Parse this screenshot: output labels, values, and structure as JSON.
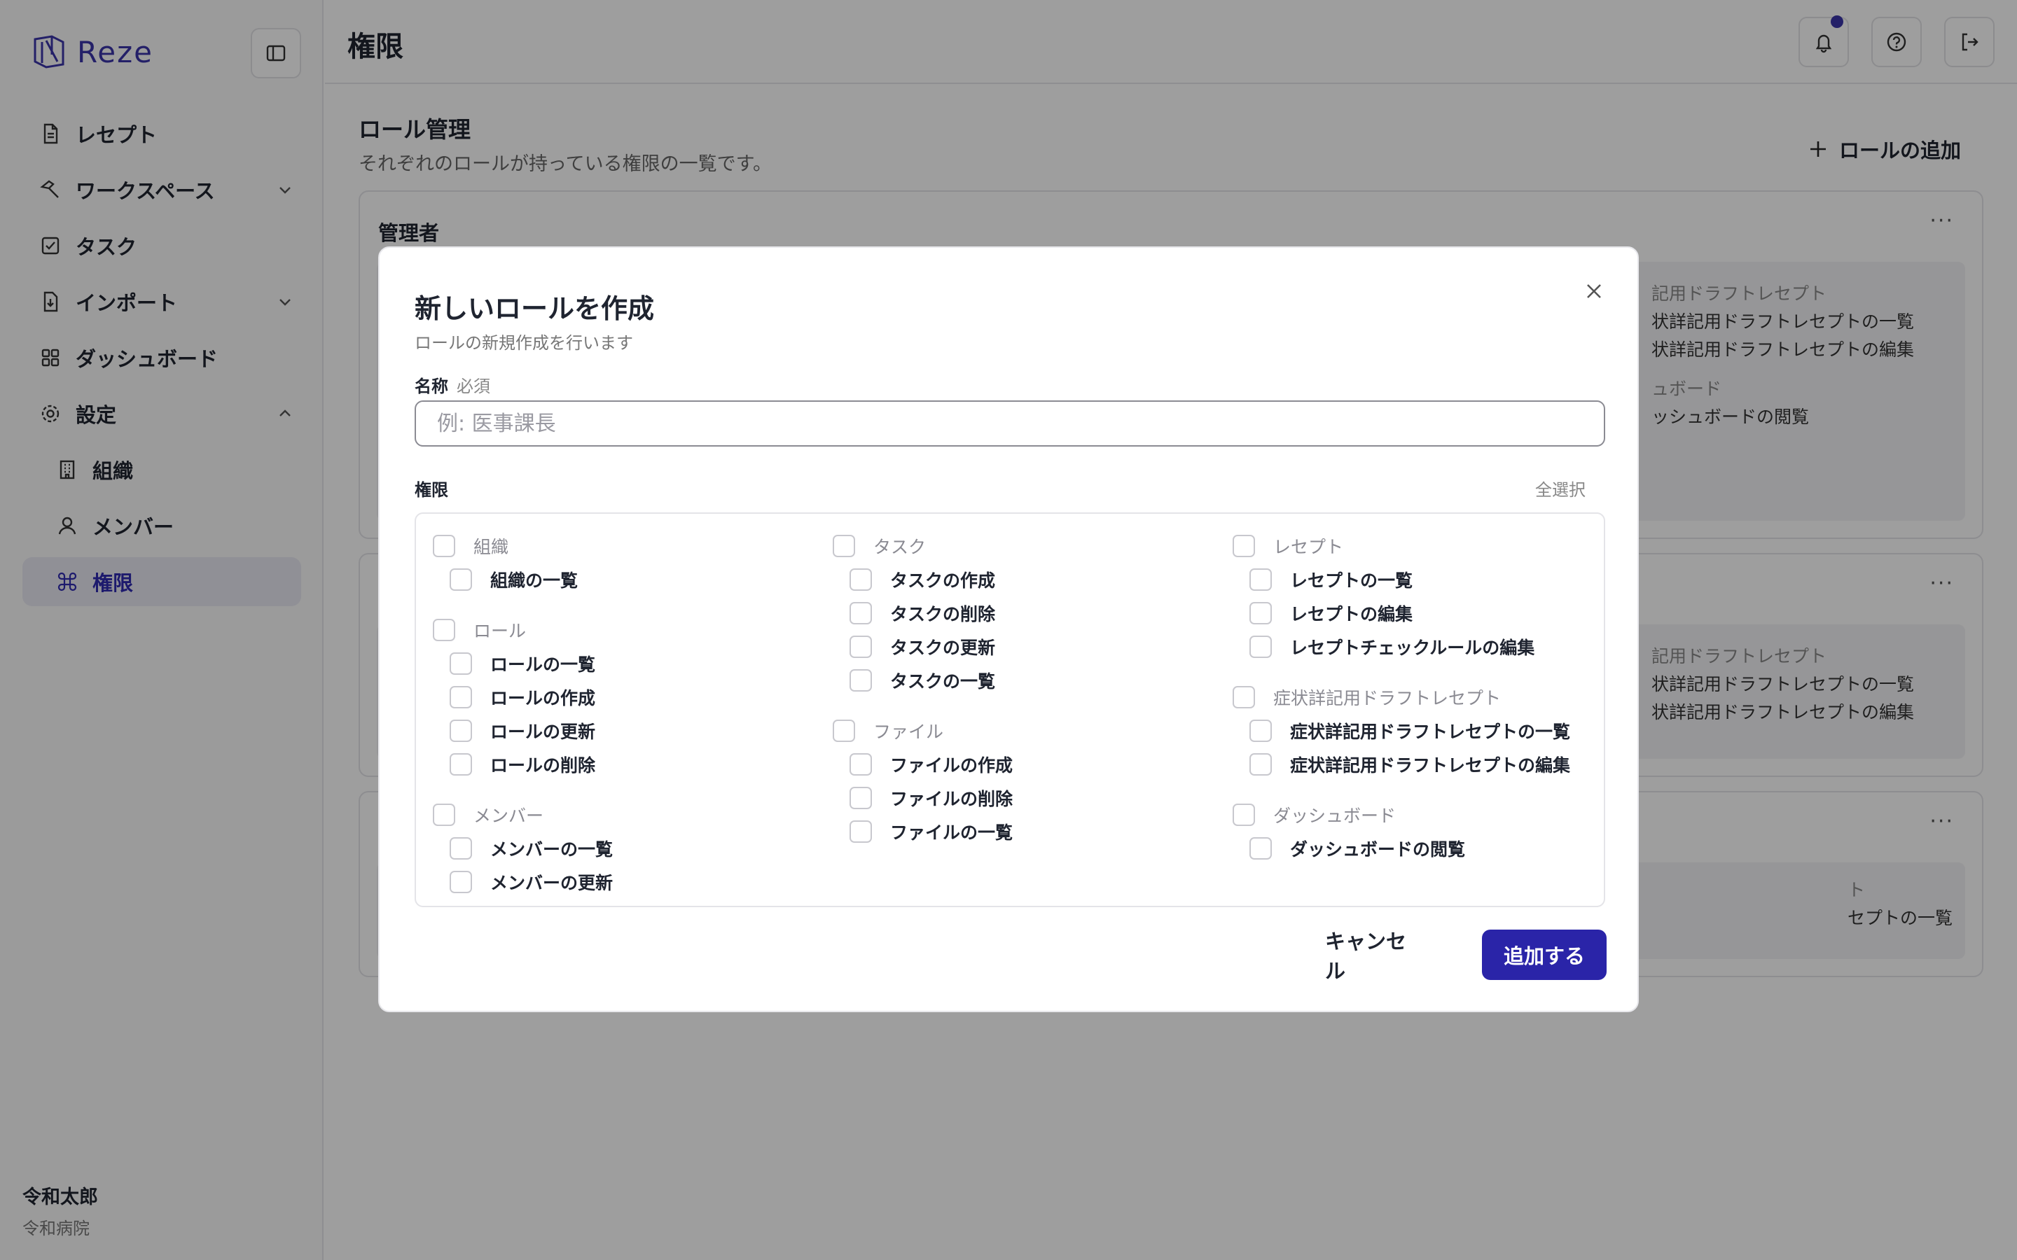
{
  "app": {
    "brand": "Reze"
  },
  "sidebar": {
    "items": [
      {
        "label": "レセプト"
      },
      {
        "label": "ワークスペース"
      },
      {
        "label": "タスク"
      },
      {
        "label": "インポート"
      },
      {
        "label": "ダッシュボード"
      },
      {
        "label": "設定"
      },
      {
        "label": "組織"
      },
      {
        "label": "メンバー"
      },
      {
        "label": "権限"
      }
    ],
    "user": {
      "name": "令和太郎",
      "org": "令和病院"
    }
  },
  "header": {
    "title": "権限"
  },
  "main": {
    "section_title": "ロール管理",
    "section_subtitle": "それぞれのロールが持っている権限の一覧です。",
    "add_role": "ロールの追加",
    "roles": [
      {
        "name": "管理者",
        "preview": [
          "記用ドラフトレセプト",
          "状詳記用ドラフトレセプトの一覧",
          "状詳記用ドラフトレセプトの編集",
          "ュボード",
          "ッシュボードの閲覧"
        ]
      },
      {
        "name": "",
        "preview": [
          "記用ドラフトレセプト",
          "状詳記用ドラフトレセプトの一覧",
          "状詳記用ドラフトレセプトの編集"
        ]
      },
      {
        "name": "",
        "preview": [
          "ト",
          "セプトの一覧"
        ]
      }
    ]
  },
  "modal": {
    "title": "新しいロールを作成",
    "subtitle": "ロールの新規作成を行います",
    "name_label": "名称",
    "name_required": "必須",
    "name_placeholder": "例: 医事課長",
    "name_value": "",
    "permissions_label": "権限",
    "select_all": "全選択",
    "cancel": "キャンセル",
    "submit": "追加する",
    "columns": [
      [
        {
          "group": "組織",
          "items": [
            "組織の一覧"
          ]
        },
        {
          "group": "ロール",
          "items": [
            "ロールの一覧",
            "ロールの作成",
            "ロールの更新",
            "ロールの削除"
          ]
        },
        {
          "group": "メンバー",
          "items": [
            "メンバーの一覧",
            "メンバーの更新"
          ]
        }
      ],
      [
        {
          "group": "タスク",
          "items": [
            "タスクの作成",
            "タスクの削除",
            "タスクの更新",
            "タスクの一覧"
          ]
        },
        {
          "group": "ファイル",
          "items": [
            "ファイルの作成",
            "ファイルの削除",
            "ファイルの一覧"
          ]
        }
      ],
      [
        {
          "group": "レセプト",
          "items": [
            "レセプトの一覧",
            "レセプトの編集",
            "レセプトチェックルールの編集"
          ]
        },
        {
          "group": "症状詳記用ドラフトレセプト",
          "items": [
            "症状詳記用ドラフトレセプトの一覧",
            "症状詳記用ドラフトレセプトの編集"
          ]
        },
        {
          "group": "ダッシュボード",
          "items": [
            "ダッシュボードの閲覧"
          ]
        }
      ]
    ]
  }
}
